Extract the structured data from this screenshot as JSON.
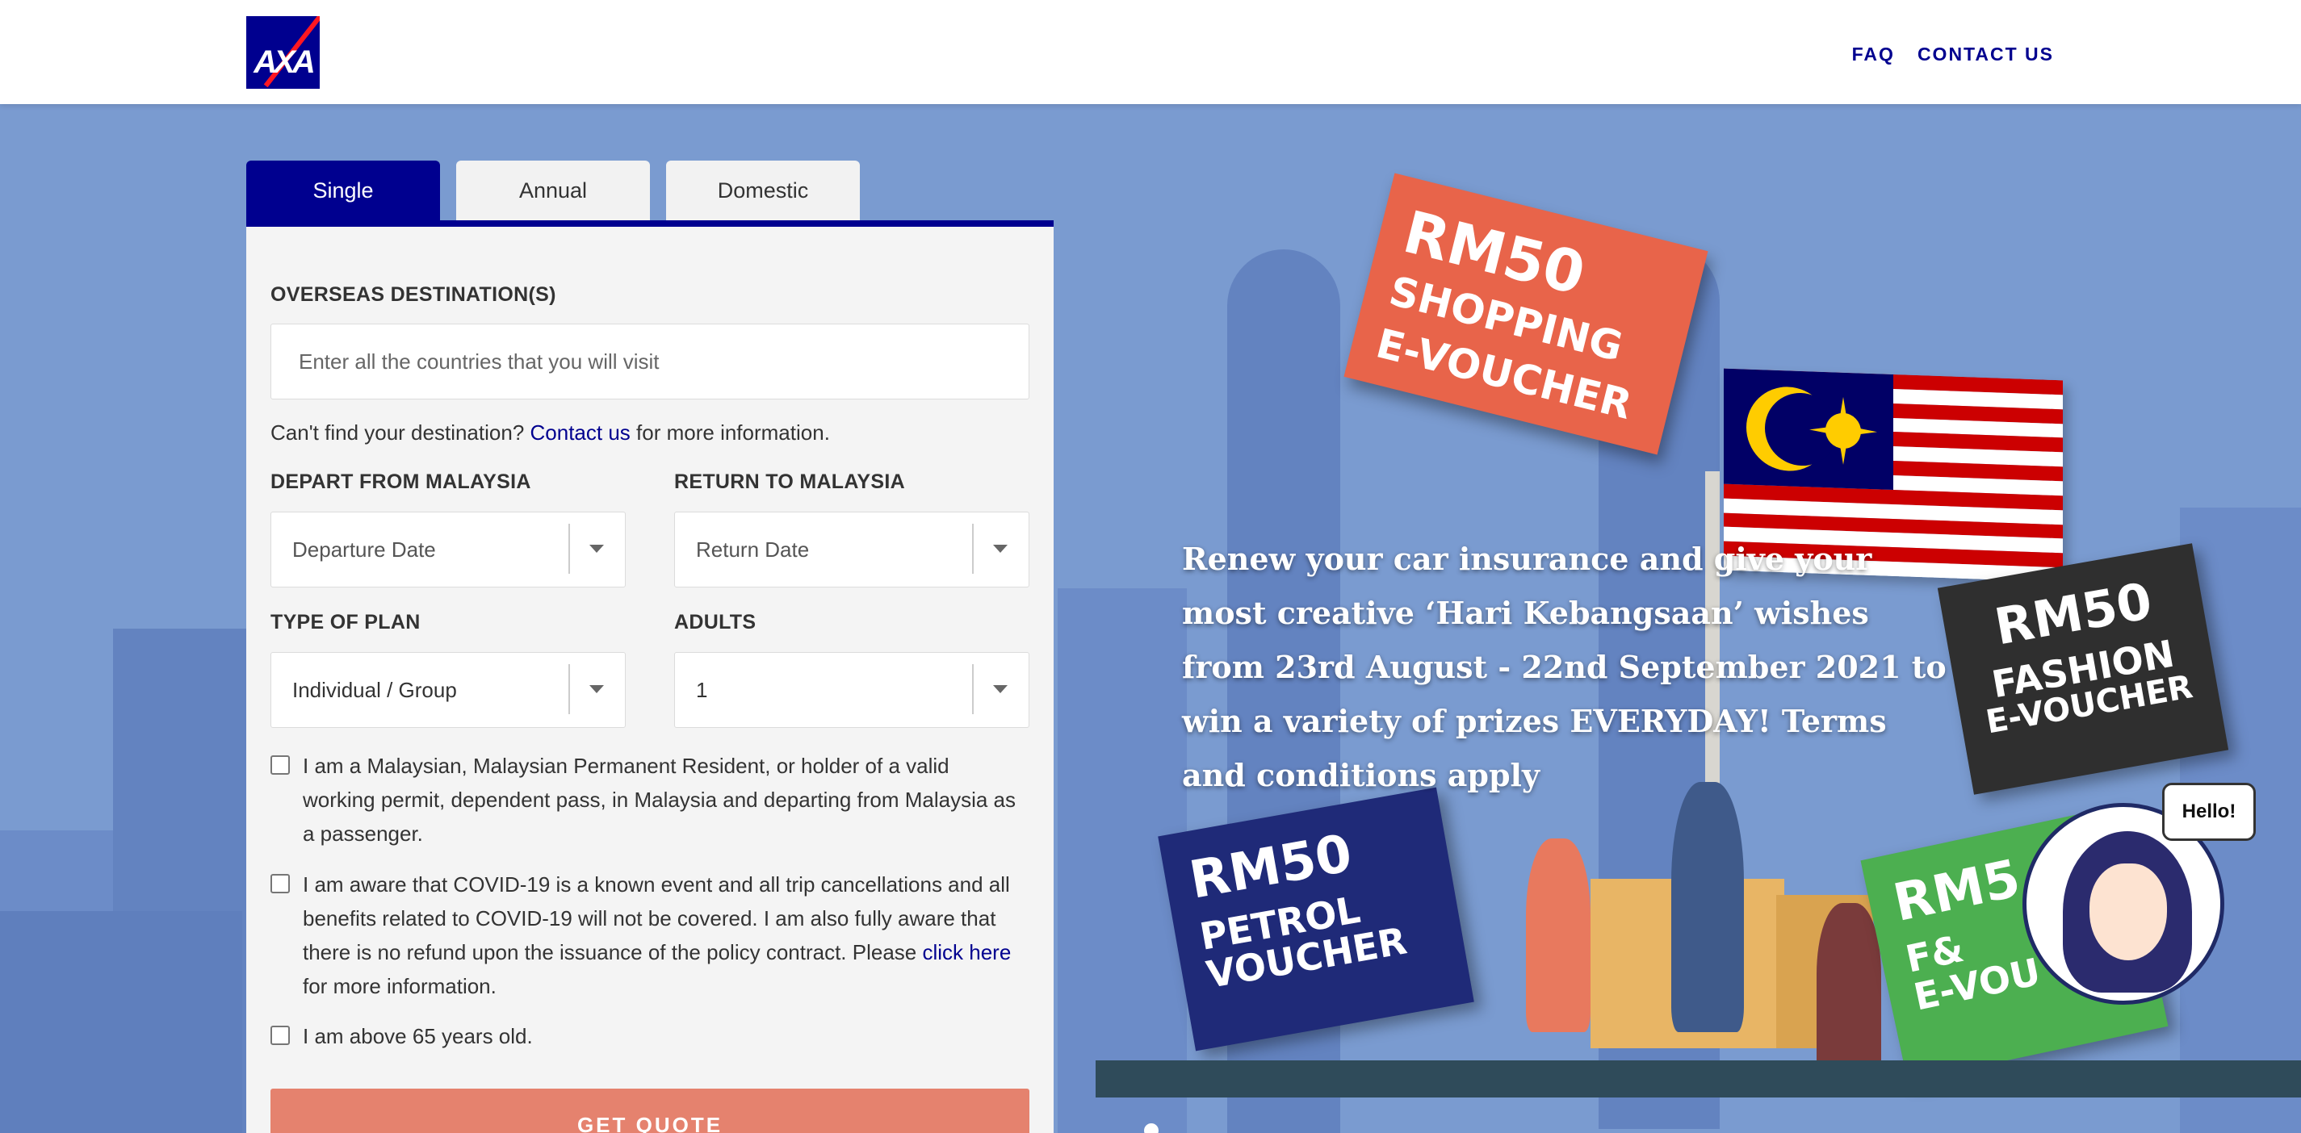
{
  "header": {
    "logo_text": "AXA",
    "nav": [
      {
        "label": "FAQ"
      },
      {
        "label": "CONTACT US"
      }
    ]
  },
  "tabs": [
    {
      "label": "Single",
      "active": true
    },
    {
      "label": "Annual",
      "active": false
    },
    {
      "label": "Domestic",
      "active": false
    }
  ],
  "form": {
    "destination_label": "OVERSEAS DESTINATION(S)",
    "destination_placeholder": "Enter all the countries that you will visit",
    "help_prefix": "Can't find your destination?",
    "help_link": "Contact us",
    "help_suffix": "for more information.",
    "depart_label": "DEPART FROM MALAYSIA",
    "depart_placeholder": "Departure Date",
    "return_label": "RETURN TO MALAYSIA",
    "return_placeholder": "Return Date",
    "plan_label": "TYPE OF PLAN",
    "plan_value": "Individual / Group",
    "adults_label": "ADULTS",
    "adults_value": "1",
    "check1": "I am a Malaysian, Malaysian Permanent Resident, or holder of a valid working permit, dependent pass, in Malaysia and departing from Malaysia as a passenger.",
    "check2_text": "I am aware that COVID-19 is a known event and all trip cancellations and all benefits related to COVID-19 will not be covered. I am also fully aware that there is no refund upon the issuance of the policy contract. Please",
    "check2_link": "click here",
    "check2_suffix": "for more information.",
    "check3": "I am above 65 years old.",
    "submit": "GET QUOTE"
  },
  "promo": {
    "text": "Renew your car insurance and give your most creative ‘Hari Kebangsaan’ wishes from 23rd August - 22nd September 2021 to win a variety of prizes EVERYDAY! Terms and conditions apply",
    "vouchers": [
      {
        "amount": "RM50",
        "line1": "SHOPPING",
        "line2": "E-VOUCHER",
        "color": "#e8644a"
      },
      {
        "amount": "RM50",
        "line1": "FASHION",
        "line2": "E-VOUCHER",
        "color": "#2f2f2f"
      },
      {
        "amount": "RM50",
        "line1": "PETROL",
        "line2": "VOUCHER",
        "color": "#1f2a78"
      },
      {
        "amount": "RM5",
        "line1": "F&",
        "line2": "E-VOU",
        "color": "#4caf50"
      }
    ],
    "bubble": "Hello!"
  },
  "colors": {
    "brand": "#00008f",
    "accent_red": "#ff1721",
    "cta": "#e5826e",
    "hero_bg": "#7a9bd0"
  }
}
